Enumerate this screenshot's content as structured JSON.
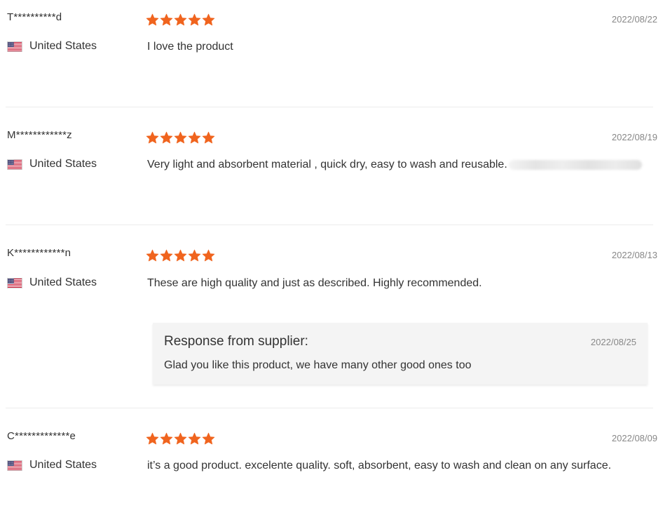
{
  "colors": {
    "star": "#f0641e",
    "divider": "#ececec",
    "date_text": "#888888",
    "response_bg": "#f4f4f4"
  },
  "reviews": [
    {
      "username": "T**********d",
      "country": "United States",
      "rating": 5,
      "date": "2022/08/22",
      "text": "I love the product"
    },
    {
      "username": "M************z",
      "country": "United States",
      "rating": 5,
      "date": "2022/08/19",
      "text": "Very light and absorbent material , quick dry, easy to wash and reusable."
    },
    {
      "username": "K************n",
      "country": "United States",
      "rating": 5,
      "date": "2022/08/13",
      "text": "These are high quality and just as described. Highly recommended.",
      "response": {
        "title": "Response from supplier:",
        "date": "2022/08/25",
        "text": "Glad you like this product, we have many other good ones too"
      }
    },
    {
      "username": "C*************e",
      "country": "United States",
      "rating": 5,
      "date": "2022/08/09",
      "text": "it’s a good product. excelente quality. soft, absorbent, easy to wash and clean on any surface."
    }
  ]
}
